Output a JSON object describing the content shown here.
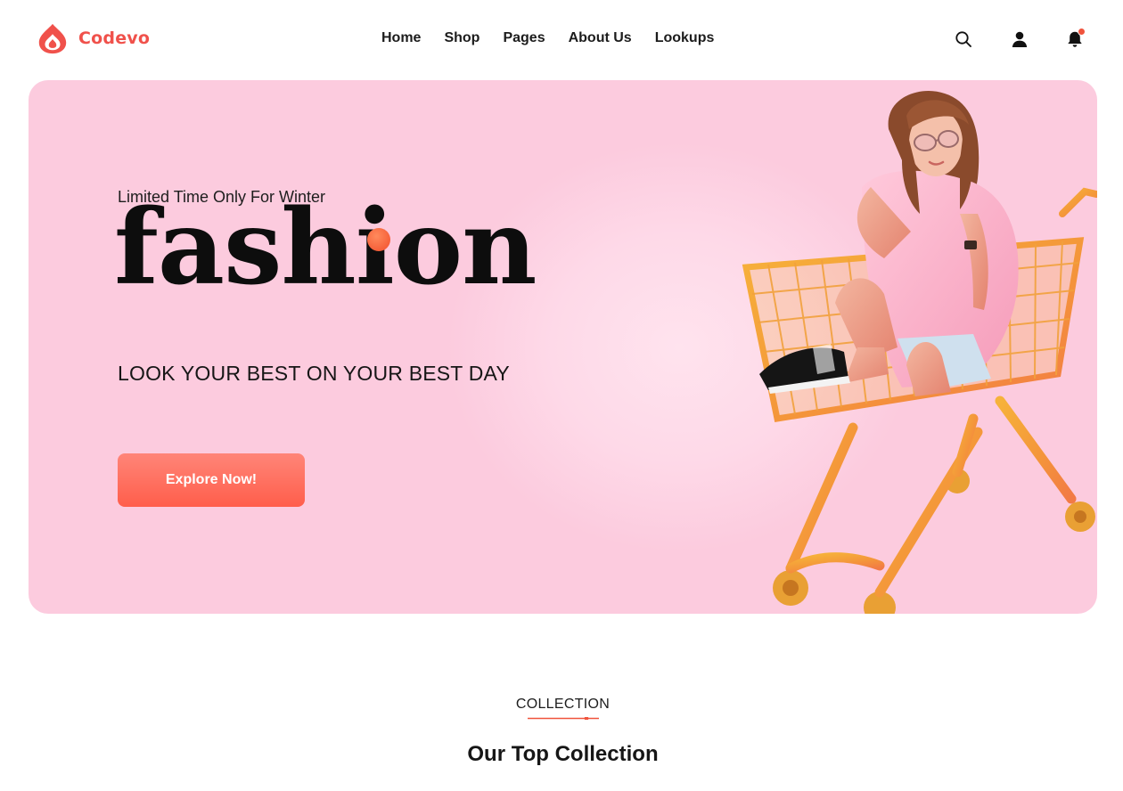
{
  "brand": {
    "name": "Codevo",
    "icon": "flame-drop-logo-icon",
    "color": "#f0514b"
  },
  "nav": {
    "items": [
      {
        "label": "Home"
      },
      {
        "label": "Shop"
      },
      {
        "label": "Pages"
      },
      {
        "label": "About Us"
      },
      {
        "label": "Lookups"
      }
    ]
  },
  "header_icons": {
    "search": "search-icon",
    "account": "user-icon",
    "notifications": "bell-icon",
    "notification_dot_color": "#f0533c"
  },
  "hero": {
    "eyebrow": "Limited Time Only For Winter",
    "title": "fashion",
    "subtitle": "LOOK YOUR BEST ON YOUR BEST DAY",
    "cta_label": "Explore Now!",
    "background_color": "#fccbde",
    "accent_color": "#ff5e4b",
    "image": "woman-in-shopping-cart-photo"
  },
  "collection": {
    "eyebrow": "COLLECTION",
    "title": "Our Top Collection"
  }
}
